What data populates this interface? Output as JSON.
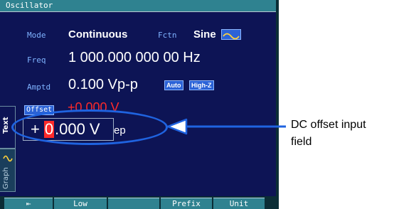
{
  "window": {
    "title": "Oscillator"
  },
  "params": {
    "mode_label": "Mode",
    "mode_value": "Continuous",
    "fctn_label": "Fctn",
    "fctn_value": "Sine",
    "freq_label": "Freq",
    "freq_value": "1 000.000 000 00 Hz",
    "amptd_label": "Amptd",
    "amptd_value": "0.100 Vp-p",
    "auto_badge": "Auto",
    "highz_badge": "High-Z",
    "offset_label": "Offset",
    "offset_value": "+0.000 V"
  },
  "offset_input": {
    "sign": "+",
    "cursor_digit": "0",
    "rest": ".000 V",
    "trailing": "ep"
  },
  "side_tabs": {
    "text": "Text",
    "graph": "Graph"
  },
  "softkeys": [
    {
      "label": "⇤",
      "icon": "back-arrow-icon"
    },
    {
      "label": "Low"
    },
    {
      "label": ""
    },
    {
      "label": "Prefix"
    },
    {
      "label": "Unit"
    }
  ],
  "annotation": {
    "line1": "DC offset input",
    "line2": "field",
    "color": "#1f63e0"
  },
  "colors": {
    "screen_bg": "#0d1455",
    "title_bar": "#2f8290",
    "label_blue": "#7fb3ff",
    "badge_blue": "#2b62d6",
    "active_red": "#ff2a2a"
  }
}
